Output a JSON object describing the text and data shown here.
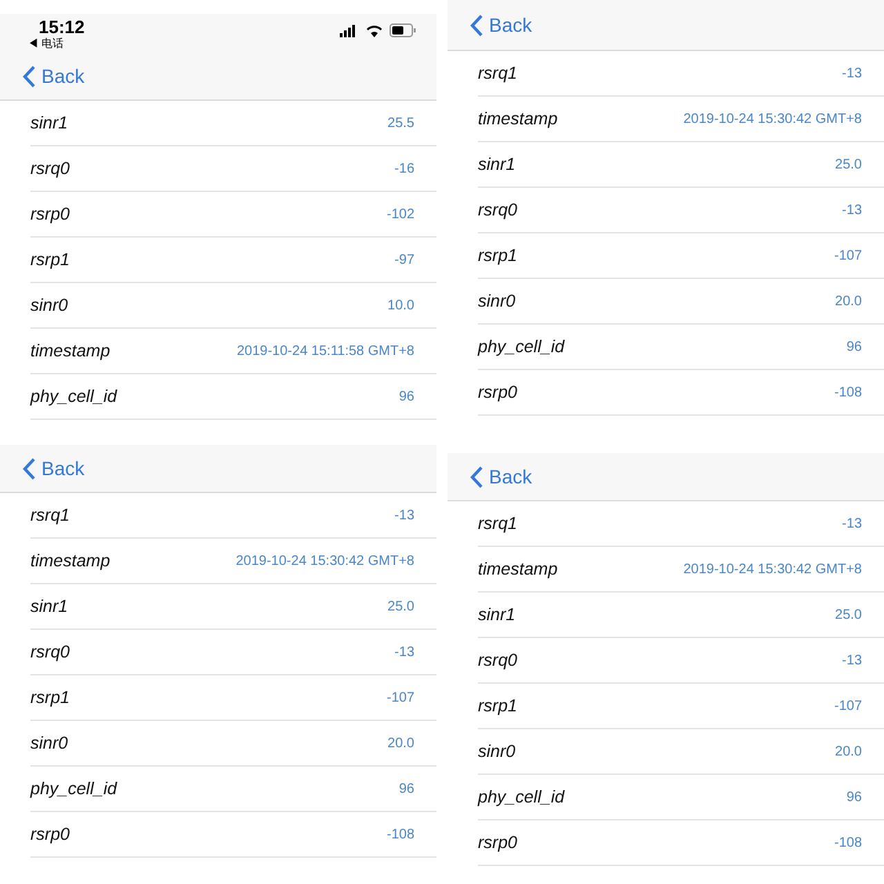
{
  "screens": [
    {
      "status_bar": {
        "time": "15:12",
        "back_to_app": "◀ 电话"
      },
      "nav": {
        "back": "Back"
      },
      "rows": [
        {
          "label": "sinr1",
          "value": "25.5"
        },
        {
          "label": "rsrq0",
          "value": "-16"
        },
        {
          "label": "rsrp0",
          "value": "-102"
        },
        {
          "label": "rsrp1",
          "value": "-97"
        },
        {
          "label": "sinr0",
          "value": "10.0"
        },
        {
          "label": "timestamp",
          "value": "2019-10-24 15:11:58 GMT+8"
        },
        {
          "label": "phy_cell_id",
          "value": "96"
        }
      ]
    },
    {
      "nav": {
        "back": "Back"
      },
      "rows": [
        {
          "label": "rsrq1",
          "value": "-13"
        },
        {
          "label": "timestamp",
          "value": "2019-10-24 15:30:42 GMT+8"
        },
        {
          "label": "sinr1",
          "value": "25.0"
        },
        {
          "label": "rsrq0",
          "value": "-13"
        },
        {
          "label": "rsrp1",
          "value": "-107"
        },
        {
          "label": "sinr0",
          "value": "20.0"
        },
        {
          "label": "phy_cell_id",
          "value": "96"
        },
        {
          "label": "rsrp0",
          "value": "-108"
        }
      ]
    },
    {
      "nav": {
        "back": "Back"
      },
      "rows": [
        {
          "label": "rsrq1",
          "value": "-13"
        },
        {
          "label": "timestamp",
          "value": "2019-10-24 15:30:42 GMT+8"
        },
        {
          "label": "sinr1",
          "value": "25.0"
        },
        {
          "label": "rsrq0",
          "value": "-13"
        },
        {
          "label": "rsrp1",
          "value": "-107"
        },
        {
          "label": "sinr0",
          "value": "20.0"
        },
        {
          "label": "phy_cell_id",
          "value": "96"
        },
        {
          "label": "rsrp0",
          "value": "-108"
        }
      ]
    },
    {
      "nav": {
        "back": "Back"
      },
      "rows": [
        {
          "label": "rsrq1",
          "value": "-13"
        },
        {
          "label": "timestamp",
          "value": "2019-10-24 15:30:42 GMT+8"
        },
        {
          "label": "sinr1",
          "value": "25.0"
        },
        {
          "label": "rsrq0",
          "value": "-13"
        },
        {
          "label": "rsrp1",
          "value": "-107"
        },
        {
          "label": "sinr0",
          "value": "20.0"
        },
        {
          "label": "phy_cell_id",
          "value": "96"
        },
        {
          "label": "rsrp0",
          "value": "-108"
        }
      ]
    }
  ]
}
